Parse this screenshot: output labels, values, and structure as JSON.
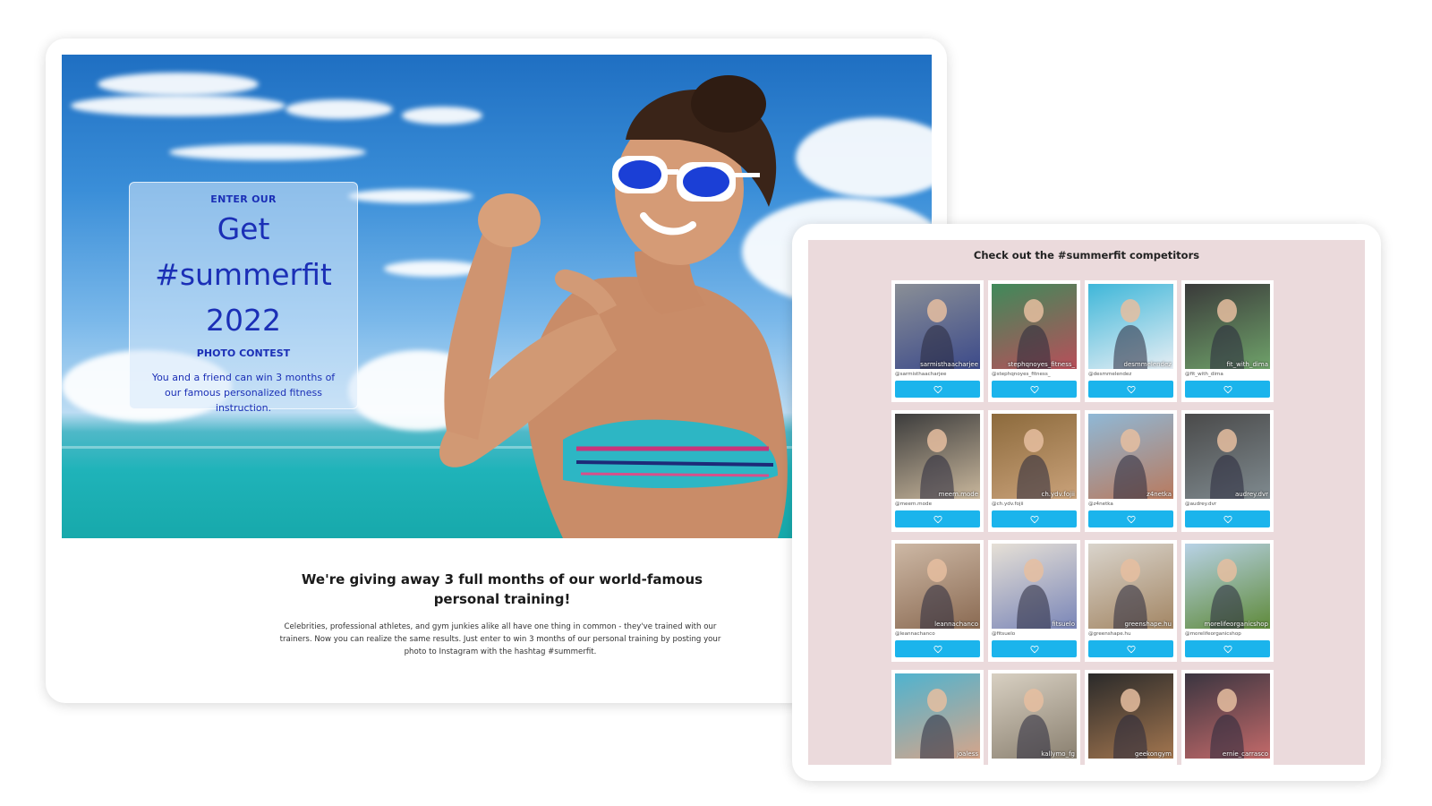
{
  "promo": {
    "pre_title": "ENTER OUR",
    "title_line1": "Get",
    "title_line2": "#summerfit",
    "title_line3": "2022",
    "subtitle": "PHOTO CONTEST",
    "description": "You and a friend can win 3 months of our famous personalized fitness instruction."
  },
  "content": {
    "headline": "We're giving away 3 full months of our world-famous personal training!",
    "body": "Celebrities, professional athletes, and gym junkies alike all have one thing in common - they've trained with our trainers. Now you can realize the same results. Just enter to win 3 months of our personal training by posting your photo to Instagram with the hashtag #summerfit."
  },
  "gallery": {
    "title": "Check out the #summerfit competitors",
    "items": [
      {
        "label": "sarmisthaacharjee",
        "handle": "@sarmisthaacharjee",
        "c1": "#8a8f96",
        "c2": "#3c4a8a"
      },
      {
        "label": "stephqnoyes_fitness_",
        "handle": "@stephqnoyes_fitness_",
        "c1": "#3f8a5a",
        "c2": "#b84f5a"
      },
      {
        "label": "desmmelendez",
        "handle": "@desmmelendez",
        "c1": "#3fb7d9",
        "c2": "#e7eef4"
      },
      {
        "label": "fit_with_dima",
        "handle": "@fit_with_dima",
        "c1": "#3a3a3a",
        "c2": "#6fa26a"
      },
      {
        "label": "meem.mode",
        "handle": "@meem.mode",
        "c1": "#3c3c3c",
        "c2": "#c9b79c"
      },
      {
        "label": "ch.ydv.fojii",
        "handle": "@ch.ydv.fojii",
        "c1": "#8c6a3c",
        "c2": "#caa27a"
      },
      {
        "label": "z4netka",
        "handle": "@z4netka",
        "c1": "#8fb8d6",
        "c2": "#b97a5e"
      },
      {
        "label": "audrey.dvr",
        "handle": "@audrey.dvr",
        "c1": "#4a4a4a",
        "c2": "#7f8a8f"
      },
      {
        "label": "leannachanco",
        "handle": "@leannachanco",
        "c1": "#cdb8a5",
        "c2": "#8a6a52"
      },
      {
        "label": "fitsuelo",
        "handle": "@fitsuelo",
        "c1": "#e6e0d6",
        "c2": "#7a86b8"
      },
      {
        "label": "greenshape.hu",
        "handle": "@greenshape.hu",
        "c1": "#d9d4cc",
        "c2": "#a38664"
      },
      {
        "label": "morelifeorganicshop",
        "handle": "@morelifeorganicshop",
        "c1": "#b8d2e6",
        "c2": "#5f8a3a"
      },
      {
        "label": "joaless",
        "handle": "",
        "c1": "#4fb3cf",
        "c2": "#d6a58a"
      },
      {
        "label": "kallymo_fg",
        "handle": "",
        "c1": "#d8d0c2",
        "c2": "#8a8070"
      },
      {
        "label": "geekongym",
        "handle": "",
        "c1": "#2a2a2a",
        "c2": "#a3764f"
      },
      {
        "label": "ernie_carrasco",
        "handle": "",
        "c1": "#3a3540",
        "c2": "#c46a6a"
      }
    ]
  }
}
